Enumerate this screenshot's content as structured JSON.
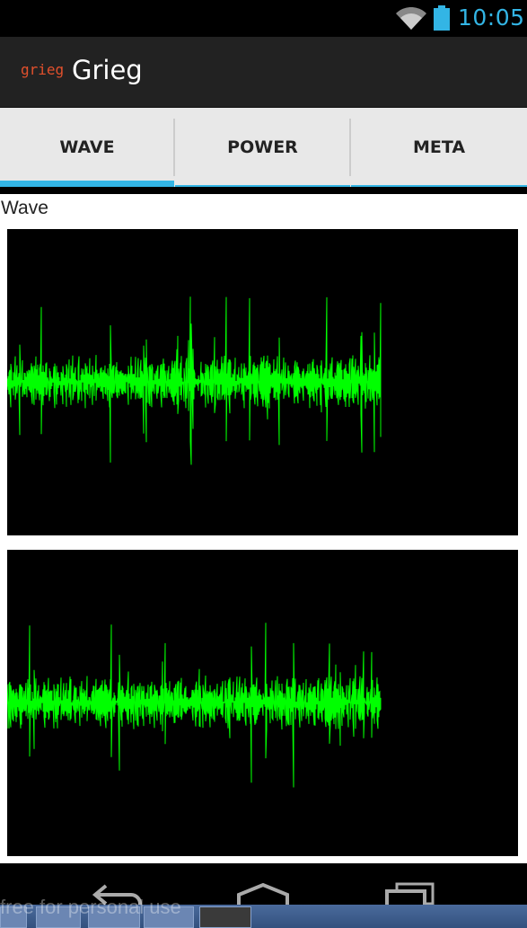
{
  "status_bar": {
    "time": "10:05",
    "wifi_icon": "wifi-icon",
    "battery_icon": "battery-icon",
    "accent": "#33b5e5"
  },
  "action_bar": {
    "logo_text": "grieg",
    "title": "Grieg",
    "logo_color": "#e2502c"
  },
  "tabs": [
    {
      "label": "WAVE",
      "active": true
    },
    {
      "label": "POWER",
      "active": false
    },
    {
      "label": "META",
      "active": false
    }
  ],
  "content": {
    "section_label": "Wave",
    "waveform_color": "#00ff00",
    "channels": [
      {
        "id": "channel-1"
      },
      {
        "id": "channel-2"
      }
    ]
  },
  "nav_bar": {
    "back_icon": "back-icon",
    "home_icon": "home-icon",
    "recents_icon": "recent-apps-icon"
  },
  "taskbar": {
    "watermark": "free for personal use"
  }
}
